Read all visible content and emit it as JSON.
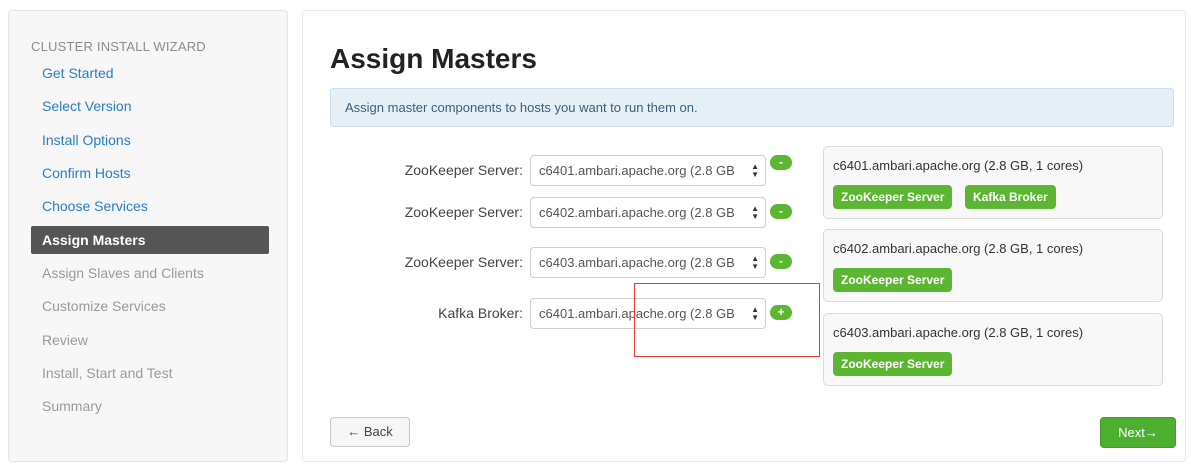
{
  "sidebar": {
    "heading": "CLUSTER INSTALL WIZARD",
    "items": [
      {
        "label": "Get Started",
        "state": "done"
      },
      {
        "label": "Select Version",
        "state": "done"
      },
      {
        "label": "Install Options",
        "state": "done"
      },
      {
        "label": "Confirm Hosts",
        "state": "done"
      },
      {
        "label": "Choose Services",
        "state": "done"
      },
      {
        "label": "Assign Masters",
        "state": "active"
      },
      {
        "label": "Assign Slaves and Clients",
        "state": "pending"
      },
      {
        "label": "Customize Services",
        "state": "pending"
      },
      {
        "label": "Review",
        "state": "pending"
      },
      {
        "label": "Install, Start and Test",
        "state": "pending"
      },
      {
        "label": "Summary",
        "state": "pending"
      }
    ]
  },
  "main": {
    "title": "Assign Masters",
    "info": "Assign master components to hosts you want to run them on.",
    "assignments": [
      {
        "label": "ZooKeeper Server:",
        "host": "c6401.ambari.apache.org (2.8 GB",
        "action": "-"
      },
      {
        "label": "ZooKeeper Server:",
        "host": "c6402.ambari.apache.org (2.8 GB",
        "action": "-"
      },
      {
        "label": "ZooKeeper Server:",
        "host": "c6403.ambari.apache.org (2.8 GB",
        "action": "-"
      },
      {
        "label": "Kafka Broker:",
        "host": "c6401.ambari.apache.org (2.8 GB",
        "action": "+"
      }
    ],
    "hosts": [
      {
        "name": "c6401.ambari.apache.org (2.8 GB, 1 cores)",
        "components": [
          "ZooKeeper Server",
          "Kafka Broker"
        ]
      },
      {
        "name": "c6402.ambari.apache.org (2.8 GB, 1 cores)",
        "components": [
          "ZooKeeper Server"
        ]
      },
      {
        "name": "c6403.ambari.apache.org (2.8 GB, 1 cores)",
        "components": [
          "ZooKeeper Server"
        ]
      }
    ],
    "back_label": "← Back",
    "next_label": "Next→"
  },
  "colors": {
    "accent_green": "#5cb631",
    "link_blue": "#2a7ec6",
    "active_nav": "#555555",
    "highlight_red": "#e23b3b"
  }
}
